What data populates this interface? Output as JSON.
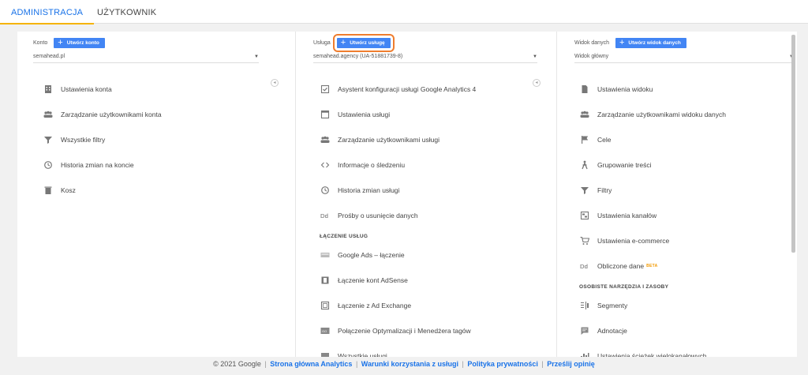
{
  "tabs": {
    "admin": "ADMINISTRACJA",
    "user": "UŻYTKOWNIK"
  },
  "account": {
    "label": "Konto",
    "create_button": "Utwórz konto",
    "selected": "semahead.pl",
    "items": [
      {
        "icon": "building-icon",
        "label": "Ustawienia konta"
      },
      {
        "icon": "users-icon",
        "label": "Zarządzanie użytkownikami konta"
      },
      {
        "icon": "filter-icon",
        "label": "Wszystkie filtry"
      },
      {
        "icon": "history-icon",
        "label": "Historia zmian na koncie"
      },
      {
        "icon": "trash-icon",
        "label": "Kosz"
      }
    ]
  },
  "property": {
    "label": "Usługa",
    "create_button": "Utwórz usługę",
    "selected": "semahead.agency (UA-51881739-8)",
    "items": [
      {
        "icon": "checklist-icon",
        "label": "Asystent konfiguracji usługi Google Analytics 4"
      },
      {
        "icon": "window-icon",
        "label": "Ustawienia usługi"
      },
      {
        "icon": "users-icon",
        "label": "Zarządzanie użytkownikami usługi"
      },
      {
        "icon": "code-icon",
        "label": "Informacje o śledzeniu"
      },
      {
        "icon": "history-icon",
        "label": "Historia zmian usługi"
      },
      {
        "icon": "dd-icon",
        "label": "Prośby o usunięcie danych"
      }
    ],
    "section_title": "ŁĄCZENIE USŁUG",
    "link_items": [
      {
        "icon": "google-ads-icon",
        "label": "Google Ads – łączenie"
      },
      {
        "icon": "adsense-icon",
        "label": "Łączenie kont AdSense"
      },
      {
        "icon": "ad-exchange-icon",
        "label": "Łączenie z Ad Exchange"
      },
      {
        "icon": "optimize-icon",
        "label": "Połączenie Optymalizacji i Menedżera tagów"
      },
      {
        "icon": "all-products-icon",
        "label": "Wszystkie usługi"
      }
    ]
  },
  "view": {
    "label": "Widok danych",
    "create_button": "Utwórz widok danych",
    "selected": "Widok główny",
    "items": [
      {
        "icon": "document-icon",
        "label": "Ustawienia widoku"
      },
      {
        "icon": "users-icon",
        "label": "Zarządzanie użytkownikami widoku danych"
      },
      {
        "icon": "flag-icon",
        "label": "Cele"
      },
      {
        "icon": "person-icon",
        "label": "Grupowanie treści"
      },
      {
        "icon": "filter-icon",
        "label": "Filtry"
      },
      {
        "icon": "channel-icon",
        "label": "Ustawienia kanałów"
      },
      {
        "icon": "cart-icon",
        "label": "Ustawienia e-commerce"
      },
      {
        "icon": "dd-icon",
        "label": "Obliczone dane",
        "badge": "BETA"
      }
    ],
    "section_title": "OSOBISTE NARZĘDZIA I ZASOBY",
    "tool_items": [
      {
        "icon": "segments-icon",
        "label": "Segmenty"
      },
      {
        "icon": "annotation-icon",
        "label": "Adnotacje"
      },
      {
        "icon": "multichannel-icon",
        "label": "Ustawienia ścieżek wielokanałowych"
      }
    ]
  },
  "footer": {
    "copyright": "© 2021 Google",
    "links": [
      "Strona główna Analytics",
      "Warunki korzystania z usługi",
      "Polityka prywatności",
      "Prześlij opinię"
    ],
    "separator": "|"
  },
  "colors": {
    "accent": "#1a73e8",
    "button": "#4285f4",
    "highlight": "#ef7d2e",
    "tab_underline": "#f5b400"
  }
}
